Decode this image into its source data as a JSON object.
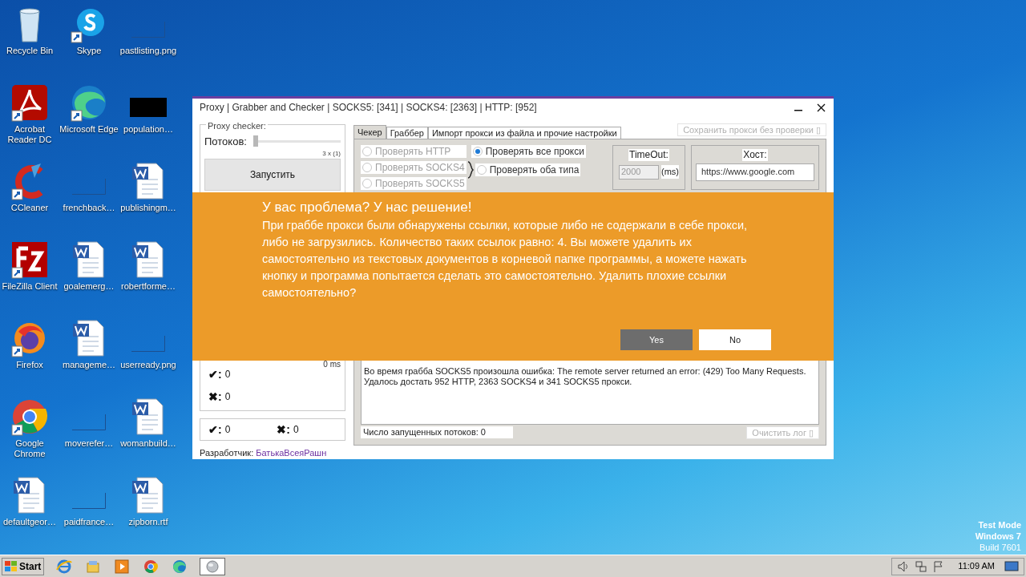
{
  "desktop": {
    "icons": [
      {
        "label": "Recycle Bin",
        "kind": "recycle",
        "shortcut": false
      },
      {
        "label": "Skype",
        "kind": "skype",
        "shortcut": true
      },
      {
        "label": "pastlisting.png",
        "kind": "blank",
        "shortcut": false
      },
      {
        "label": "Acrobat Reader DC",
        "kind": "acrobat",
        "shortcut": true
      },
      {
        "label": "Microsoft Edge",
        "kind": "edge",
        "shortcut": true
      },
      {
        "label": "population…",
        "kind": "black",
        "shortcut": false
      },
      {
        "label": "CCleaner",
        "kind": "ccleaner",
        "shortcut": true
      },
      {
        "label": "frenchback…",
        "kind": "blank",
        "shortcut": false
      },
      {
        "label": "publishingm…",
        "kind": "word",
        "shortcut": false
      },
      {
        "label": "FileZilla Client",
        "kind": "filezilla",
        "shortcut": true
      },
      {
        "label": "goalemerg…",
        "kind": "word",
        "shortcut": false
      },
      {
        "label": "robertforme…",
        "kind": "word",
        "shortcut": false
      },
      {
        "label": "Firefox",
        "kind": "firefox",
        "shortcut": true
      },
      {
        "label": "manageme…",
        "kind": "word",
        "shortcut": false
      },
      {
        "label": "userready.png",
        "kind": "blank",
        "shortcut": false
      },
      {
        "label": "Google Chrome",
        "kind": "chrome",
        "shortcut": true
      },
      {
        "label": "moverefer…",
        "kind": "blank",
        "shortcut": false
      },
      {
        "label": "womanbuild…",
        "kind": "word",
        "shortcut": false
      },
      {
        "label": "defaultgeor…",
        "kind": "word",
        "shortcut": false
      },
      {
        "label": "paidfrance…",
        "kind": "blank",
        "shortcut": false
      },
      {
        "label": "zipborn.rtf",
        "kind": "word",
        "shortcut": false
      }
    ]
  },
  "window": {
    "title": "Proxy | Grabber and Checker | SOCKS5: [341] | SOCKS4: [2363] | HTTP: [952]"
  },
  "checker_panel": {
    "legend": "Proxy checker:",
    "threads_label": "Потоков:",
    "threads_slider": {
      "level": 0.0
    },
    "slider_reading": "3 x (1)",
    "start_button": "Запустить",
    "time": "0 ms",
    "counts": [
      {
        "icon": "✔:",
        "value": "0"
      },
      {
        "icon": "✖:",
        "value": "0"
      }
    ],
    "totals": [
      {
        "icon": "✔:",
        "value": "0"
      },
      {
        "icon": "✖:",
        "value": "0"
      }
    ]
  },
  "tabs": [
    {
      "label": "Чекер",
      "selected": true
    },
    {
      "label": "Граббер",
      "selected": false
    },
    {
      "label": "Импорт прокси из файла и прочие настройки",
      "selected": false
    }
  ],
  "save_without_check": {
    "label": "Сохранить прокси без проверки ▯",
    "disabled": true
  },
  "radios": [
    {
      "label": "Проверять HTTP",
      "selected": false,
      "disabled": true
    },
    {
      "label": "Проверять все прокси",
      "selected": true,
      "disabled": false
    },
    {
      "label": "Проверять SOCKS4",
      "selected": false,
      "disabled": true
    },
    {
      "label": "Проверять оба типа",
      "selected": false,
      "disabled": false
    },
    {
      "label": "Проверять SOCKS5",
      "selected": false,
      "disabled": true
    }
  ],
  "timeout": {
    "label": "TimeOut:",
    "value": "2000",
    "unit": "(ms)",
    "disabled": true
  },
  "host": {
    "label": "Хост:",
    "value": "https://www.google.com"
  },
  "log": {
    "lines": [
      "Во время грабба SOCKS5 произошла ошибка: The remote server returned an error: (429) Too Many Requests.",
      "Удалось достать 952 HTTP, 2363 SOCKS4 и 341 SOCKS5 прокси."
    ]
  },
  "threads_status": "Число запущенных потоков: 0",
  "clear_log_button": {
    "label": "Очистить лог ▯",
    "disabled": true
  },
  "developer": {
    "label": "Разработчик:",
    "link": "БатькаВсеяРашн"
  },
  "banner": {
    "title": "У вас проблема? У нас решение!",
    "message": "При граббе прокси были обнаружены ссылки, которые либо не содержали в себе прокси, либо не загрузились. Количество таких ссылок равно: 4. Вы можете удалить их самостоятельно из текстовых документов в корневой папке программы, а можете нажать кнопку и программа попытается сделать это самостоятельно. Удалить плохие ссылки самостоятельно?",
    "buttons": [
      {
        "label": "Yes",
        "selected": true
      },
      {
        "label": "No",
        "selected": false
      }
    ]
  },
  "os_notice": [
    "Test Mode",
    "Windows 7",
    "Build 7601"
  ],
  "taskbar": {
    "start": "Start",
    "apps": [
      {
        "kind": "ie",
        "selected": false
      },
      {
        "kind": "folder",
        "selected": false
      },
      {
        "kind": "media",
        "selected": false
      },
      {
        "kind": "chrome",
        "selected": false
      },
      {
        "kind": "edge",
        "selected": false
      },
      {
        "kind": "globe",
        "selected": true
      }
    ],
    "time": "11:09 AM"
  }
}
